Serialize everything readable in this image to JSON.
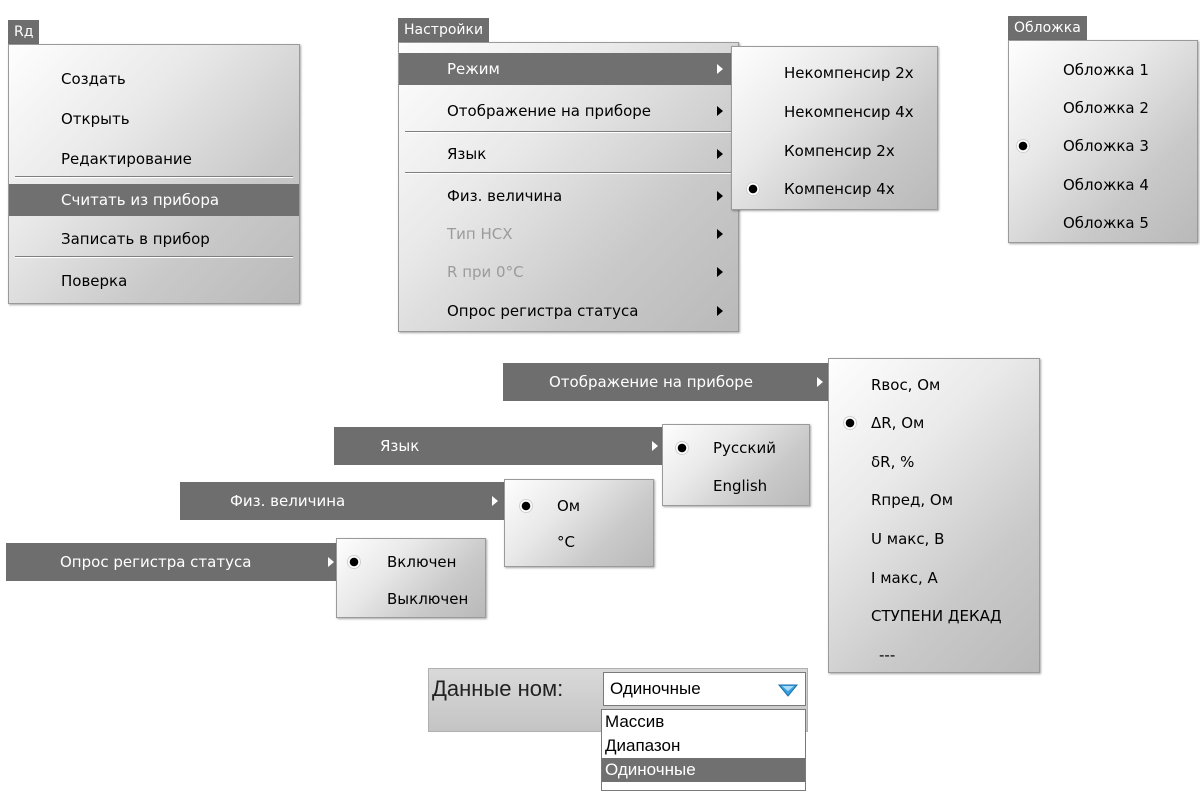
{
  "rd_menu": {
    "title": "Rд",
    "items": [
      "Создать",
      "Открыть",
      "Редактирование",
      "Считать из прибора",
      "Записать в прибор",
      "Поверка"
    ],
    "highlighted": "Считать из прибора"
  },
  "settings_menu": {
    "title": "Настройки",
    "items": [
      "Режим",
      "Отображение на приборе",
      "Язык",
      "Физ. величина",
      "Тип НСХ",
      "R при 0°C",
      "Опрос регистра статуса"
    ],
    "highlighted": "Режим",
    "disabled": [
      "Тип НСХ",
      "R при 0°C"
    ]
  },
  "mode_submenu": {
    "items": [
      "Некомпенсир 2x",
      "Некомпенсир 4x",
      "Компенсир 2x",
      "Компенсир 4x"
    ],
    "selected": "Компенсир 4x"
  },
  "cover_menu": {
    "title": "Обложка",
    "items": [
      "Обложка 1",
      "Обложка 2",
      "Обложка 3",
      "Обложка 4",
      "Обложка 5"
    ],
    "selected": "Обложка 3"
  },
  "display_bar": {
    "label": "Отображение на приборе",
    "items": [
      "Rвос, Ом",
      "ΔR, Ом",
      "δR, %",
      "Rпред, Ом",
      "U макс, B",
      "I макс, A",
      "СТУПЕНИ ДЕКАД",
      "---"
    ],
    "selected": "ΔR, Ом"
  },
  "language_bar": {
    "label": "Язык",
    "items": [
      "Русский",
      "English"
    ],
    "selected": "Русский"
  },
  "physical_bar": {
    "label": "Физ. величина",
    "items": [
      "Ом",
      "°C"
    ],
    "selected": "Ом"
  },
  "status_bar": {
    "label": "Опрос регистра статуса",
    "items": [
      "Включен",
      "Выключен"
    ],
    "selected": "Включен"
  },
  "combo": {
    "title": "Данные ном:",
    "value": "Одиночные",
    "options": [
      "Массив",
      "Диапазон",
      "Одиночные"
    ],
    "selected": "Одиночные"
  },
  "colors": {
    "highlight": "#707070",
    "tab": "#6e6e6e",
    "disabled_text": "#9b9b9b",
    "dropdown_arrow": "#3aa0e0"
  }
}
